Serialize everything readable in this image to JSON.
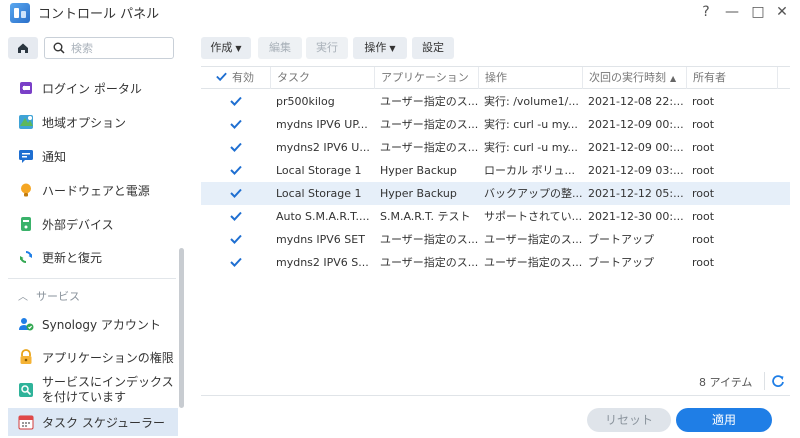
{
  "window": {
    "title": "コントロール パネル",
    "help": "?",
    "minimize": "—",
    "maximize": "□",
    "close": "✕"
  },
  "sidebar": {
    "search_placeholder": "検索",
    "items": [
      {
        "label": "ログイン ポータル",
        "icon": "login-portal-icon"
      },
      {
        "label": "地域オプション",
        "icon": "regional-options-icon"
      },
      {
        "label": "通知",
        "icon": "notification-icon"
      },
      {
        "label": "ハードウェアと電源",
        "icon": "hardware-power-icon"
      },
      {
        "label": "外部デバイス",
        "icon": "external-devices-icon"
      },
      {
        "label": "更新と復元",
        "icon": "update-restore-icon"
      }
    ],
    "section_services": "サービス",
    "service_items": [
      {
        "label": "Synology アカウント",
        "icon": "synology-account-icon"
      },
      {
        "label": "アプリケーションの権限",
        "icon": "application-privileges-icon"
      },
      {
        "label": "サービスにインデックスを付けています",
        "icon": "indexing-service-icon"
      },
      {
        "label": "タスク スケジューラー",
        "icon": "task-scheduler-icon",
        "active": true
      }
    ]
  },
  "toolbar": {
    "create": "作成",
    "edit": "編集",
    "run": "実行",
    "action": "操作",
    "settings": "設定"
  },
  "table": {
    "columns": [
      "有効",
      "タスク",
      "アプリケーション",
      "操作",
      "次回の実行時刻",
      "所有者"
    ],
    "sort_indicator": "▲",
    "rows": [
      {
        "enabled": true,
        "task": "pr500kilog",
        "app": "ユーザー指定のス...",
        "action": "実行: /volume1/...",
        "next": "2021-12-08 22:...",
        "owner": "root"
      },
      {
        "enabled": true,
        "task": "mydns IPV6 UP...",
        "app": "ユーザー指定のス...",
        "action": "実行: curl -u my...",
        "next": "2021-12-09 00:...",
        "owner": "root"
      },
      {
        "enabled": true,
        "task": "mydns2 IPV6 U...",
        "app": "ユーザー指定のス...",
        "action": "実行: curl -u my...",
        "next": "2021-12-09 00:...",
        "owner": "root"
      },
      {
        "enabled": true,
        "task": "Local Storage 1",
        "app": "Hyper Backup",
        "action": "ローカル ボリュ...",
        "next": "2021-12-09 03:...",
        "owner": "root"
      },
      {
        "enabled": true,
        "task": "Local Storage 1",
        "app": "Hyper Backup",
        "action": "バックアップの整...",
        "next": "2021-12-12 05:...",
        "owner": "root",
        "selected": true
      },
      {
        "enabled": true,
        "task": "Auto S.M.A.R.T....",
        "app": "S.M.A.R.T. テスト",
        "action": "サポートされてい...",
        "next": "2021-12-30 00:...",
        "owner": "root"
      },
      {
        "enabled": true,
        "task": "mydns IPV6 SET",
        "app": "ユーザー指定のス...",
        "action": "ユーザー指定のス...",
        "next": "ブートアップ",
        "owner": "root"
      },
      {
        "enabled": true,
        "task": "mydns2 IPV6 S...",
        "app": "ユーザー指定のス...",
        "action": "ユーザー指定のス...",
        "next": "ブートアップ",
        "owner": "root"
      }
    ]
  },
  "footer": {
    "count": "8 アイテム",
    "reset": "リセット",
    "apply": "適用"
  },
  "colors": {
    "accent": "#1f7ee6",
    "selected_row": "#e6eff9",
    "active_nav": "#dde8f5"
  }
}
